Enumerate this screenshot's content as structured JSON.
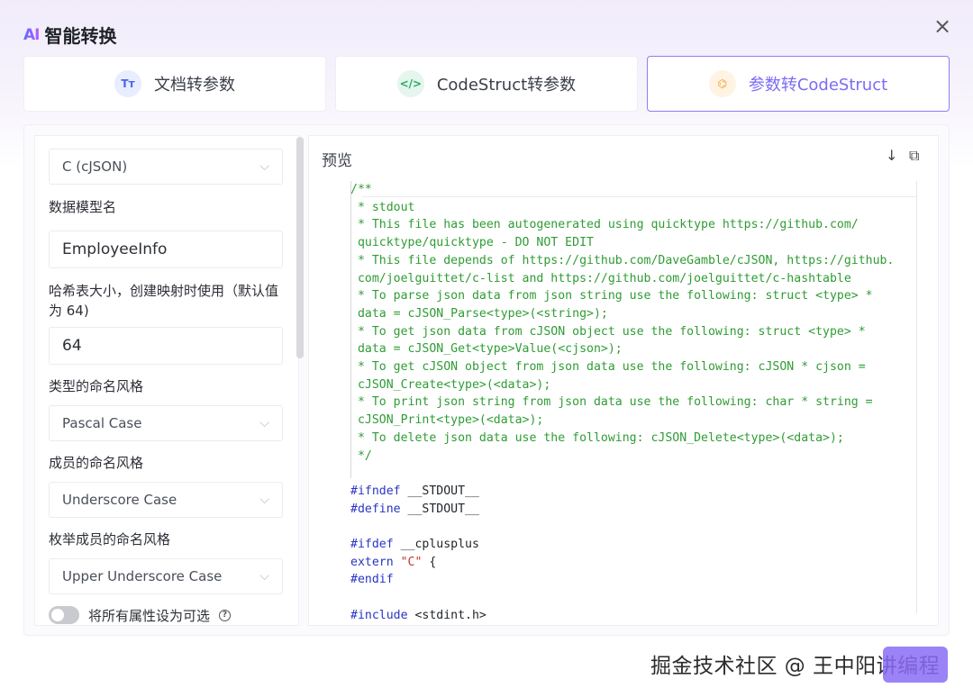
{
  "header": {
    "ai_logo": "AI",
    "title": "智能转换",
    "close_icon": "×"
  },
  "tabs": [
    {
      "label": "文档转参数",
      "icon": "Tт",
      "icon_name": "text-format-icon"
    },
    {
      "label": "CodeStruct转参数",
      "icon": "</>",
      "icon_name": "code-icon"
    },
    {
      "label": "参数转CodeStruct",
      "icon": "⌬",
      "icon_name": "convert-icon"
    }
  ],
  "form": {
    "language": "C (cJSON)",
    "model_name_label": "数据模型名",
    "model_name": "EmployeeInfo",
    "hash_label": "哈希表大小，创建映射时使用（默认值为 64)",
    "hash_value": "64",
    "type_naming_label": "类型的命名风格",
    "type_naming": "Pascal Case",
    "member_naming_label": "成员的命名风格",
    "member_naming": "Underscore Case",
    "enum_naming_label": "枚举成员的命名风格",
    "enum_naming": "Upper Underscore Case",
    "optional_toggle_label": "将所有属性设为可选"
  },
  "preview": {
    "title": "预览",
    "code_lines": [
      "/**",
      " * stdout",
      " * This file has been autogenerated using quicktype https://github.com/",
      " quicktype/quicktype - DO NOT EDIT",
      " * This file depends of https://github.com/DaveGamble/cJSON, https://github.",
      " com/joelguittet/c-list and https://github.com/joelguittet/c-hashtable",
      " * To parse json data from json string use the following: struct <type> *",
      " data = cJSON_Parse<type>(<string>);",
      " * To get json data from cJSON object use the following: struct <type> *",
      " data = cJSON_Get<type>Value(<cjson>);",
      " * To get cJSON object from json data use the following: cJSON * cjson =",
      " cJSON_Create<type>(<data>);",
      " * To print json string from json data use the following: char * string =",
      " cJSON_Print<type>(<data>);",
      " * To delete json data use the following: cJSON_Delete<type>(<data>);",
      " */",
      "",
      "#ifndef __STDOUT__",
      "#define __STDOUT__",
      "",
      "#ifdef __cplusplus",
      "extern \"C\" {",
      "#endif",
      "",
      "#include <stdint.h>"
    ]
  },
  "footer": {
    "watermark": "掘金技术社区 @ 王中阳讲编程"
  }
}
